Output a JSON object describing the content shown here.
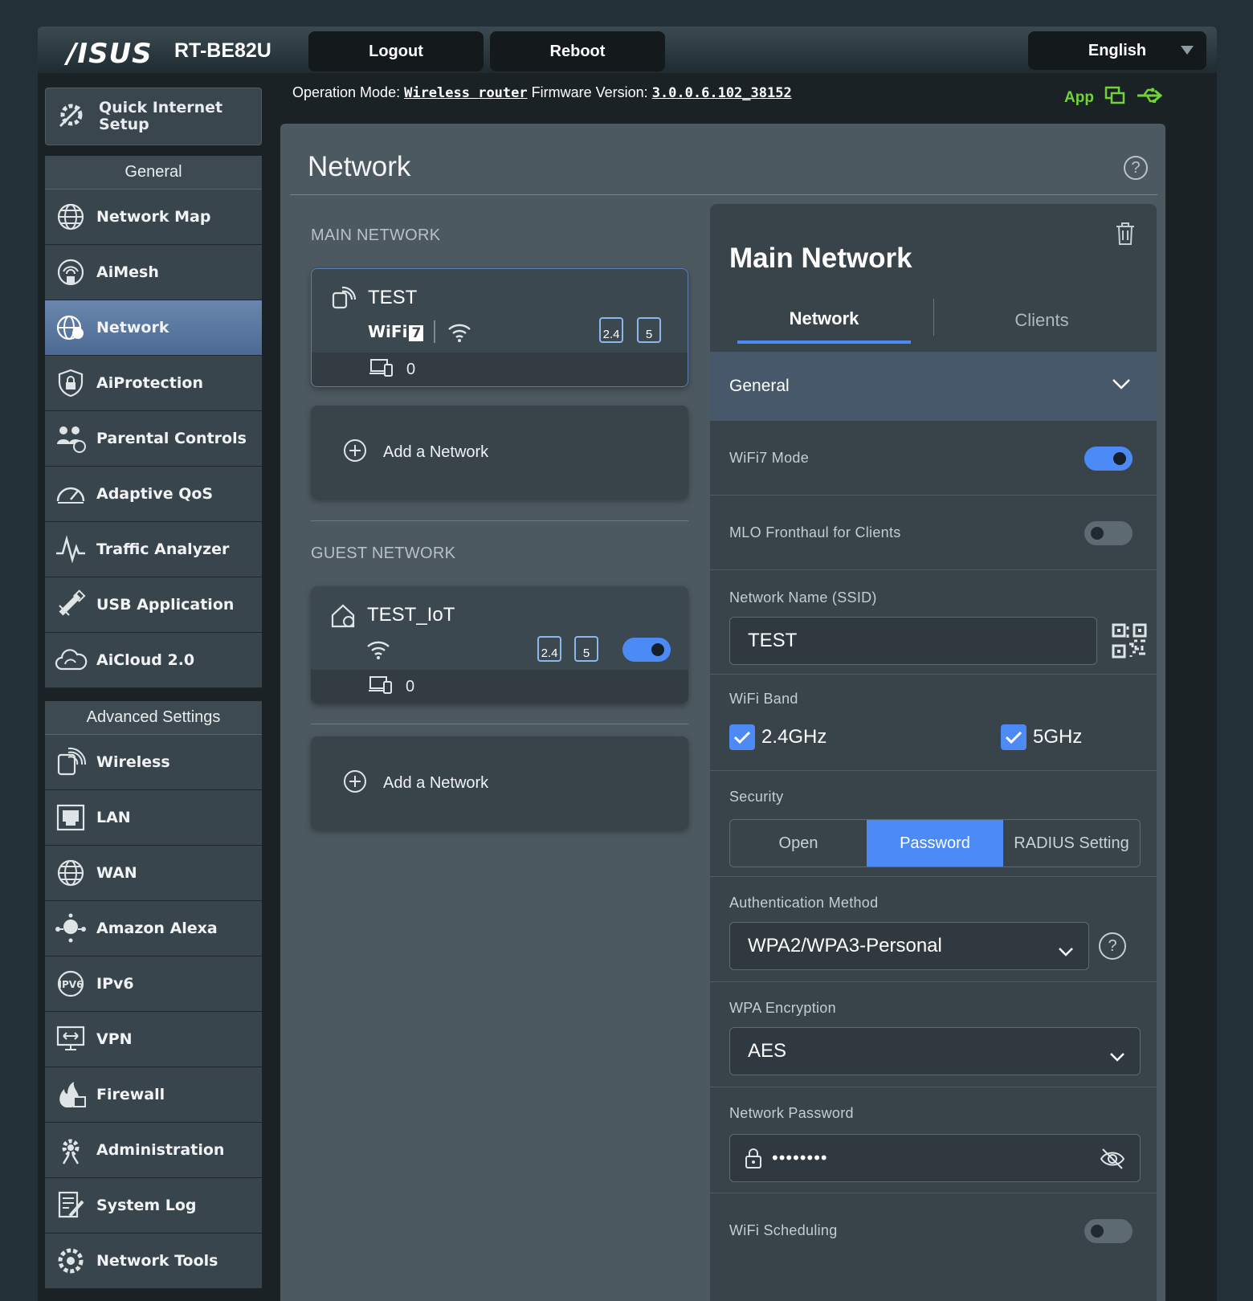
{
  "header": {
    "brand": "/ISUS",
    "model": "RT-BE82U",
    "logout_label": "Logout",
    "reboot_label": "Reboot",
    "language": "English",
    "op_mode_label": "Operation Mode:",
    "op_mode_value": "Wireless router",
    "fw_label": "Firmware Version:",
    "fw_value": "3.0.0.6.102_38152",
    "app_label": "App"
  },
  "sidebar": {
    "quick_setup": "Quick Internet Setup",
    "general_title": "General",
    "general_items": [
      {
        "label": "Network Map",
        "icon": "globe-icon"
      },
      {
        "label": "AiMesh",
        "icon": "mesh-icon"
      },
      {
        "label": "Network",
        "icon": "network-globe-icon",
        "active": true
      },
      {
        "label": "AiProtection",
        "icon": "shield-lock-icon"
      },
      {
        "label": "Parental Controls",
        "icon": "family-icon"
      },
      {
        "label": "Adaptive QoS",
        "icon": "gauge-icon"
      },
      {
        "label": "Traffic Analyzer",
        "icon": "pulse-icon"
      },
      {
        "label": "USB Application",
        "icon": "usb-icon"
      },
      {
        "label": "AiCloud 2.0",
        "icon": "cloud-icon"
      }
    ],
    "advanced_title": "Advanced Settings",
    "advanced_items": [
      {
        "label": "Wireless",
        "icon": "wifi-icon"
      },
      {
        "label": "LAN",
        "icon": "lan-icon"
      },
      {
        "label": "WAN",
        "icon": "globe-icon"
      },
      {
        "label": "Amazon Alexa",
        "icon": "alexa-icon"
      },
      {
        "label": "IPv6",
        "icon": "ipv6-icon"
      },
      {
        "label": "VPN",
        "icon": "vpn-icon"
      },
      {
        "label": "Firewall",
        "icon": "fire-icon"
      },
      {
        "label": "Administration",
        "icon": "gear-icon"
      },
      {
        "label": "System Log",
        "icon": "log-icon"
      },
      {
        "label": "Network Tools",
        "icon": "tools-icon"
      }
    ]
  },
  "main": {
    "title": "Network",
    "main_network_label": "MAIN NETWORK",
    "guest_network_label": "GUEST NETWORK",
    "main_card": {
      "name": "TEST",
      "wifi_badge": "WiFi",
      "wifi_gen": "7",
      "band_24": "2.4",
      "band_5": "5",
      "clients": "0"
    },
    "guest_card": {
      "name": "TEST_IoT",
      "band_24": "2.4",
      "band_5": "5",
      "clients": "0",
      "enabled": true
    },
    "add_network_label": "Add a Network"
  },
  "detail": {
    "title": "Main Network",
    "tab_network": "Network",
    "tab_clients": "Clients",
    "section_general": "General",
    "wifi7_mode_label": "WiFi7 Mode",
    "wifi7_mode_on": true,
    "mlo_label": "MLO Fronthaul for Clients",
    "mlo_on": false,
    "ssid_label": "Network Name (SSID)",
    "ssid_value": "TEST",
    "band_label": "WiFi Band",
    "band_24_label": "2.4GHz",
    "band_5_label": "5GHz",
    "security_label": "Security",
    "security_options": [
      "Open",
      "Password",
      "RADIUS Setting"
    ],
    "security_selected": "Password",
    "auth_label": "Authentication Method",
    "auth_value": "WPA2/WPA3-Personal",
    "enc_label": "WPA Encryption",
    "enc_value": "AES",
    "pw_label": "Network Password",
    "pw_value": "••••••••",
    "sched_label": "WiFi Scheduling",
    "sched_on": false
  },
  "colors": {
    "accent": "#4c8bf5",
    "app_green": "#71d23a"
  }
}
